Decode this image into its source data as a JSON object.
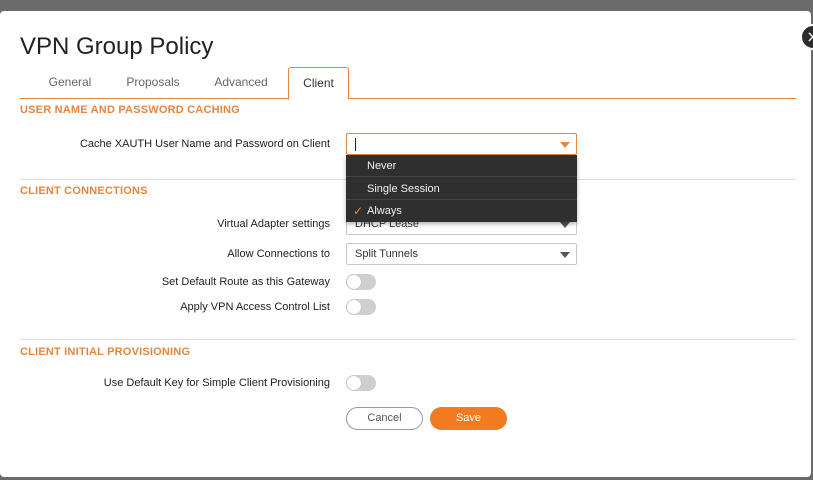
{
  "dialog": {
    "title": "VPN Group Policy",
    "close_glyph": "×"
  },
  "tabs": [
    {
      "label": "General",
      "active": false
    },
    {
      "label": "Proposals",
      "active": false
    },
    {
      "label": "Advanced",
      "active": false
    },
    {
      "label": "Client",
      "active": true
    }
  ],
  "sections": {
    "caching": {
      "title": "USER NAME AND PASSWORD CACHING",
      "cache_label": "Cache XAUTH User Name and Password on Client",
      "cache_value": ""
    },
    "connections": {
      "title": "CLIENT CONNECTIONS",
      "virtual_adapter_label": "Virtual Adapter settings",
      "virtual_adapter_value": "DHCP Lease",
      "allow_connections_label": "Allow Connections to",
      "allow_connections_value": "Split Tunnels",
      "default_route_label": "Set Default Route as this Gateway",
      "default_route_on": false,
      "acl_label": "Apply VPN Access Control List",
      "acl_on": false
    },
    "provisioning": {
      "title": "CLIENT INITIAL PROVISIONING",
      "default_key_label": "Use Default Key for Simple Client Provisioning",
      "default_key_on": false
    }
  },
  "dropdown": {
    "options": [
      {
        "label": "Never",
        "selected": false
      },
      {
        "label": "Single Session",
        "selected": false
      },
      {
        "label": "Always",
        "selected": true
      }
    ],
    "check_glyph": "✓"
  },
  "buttons": {
    "cancel_label": "Cancel",
    "save_label": "Save"
  },
  "colors": {
    "accent": "#e8853d",
    "save_button": "#f47a1f",
    "dropdown_bg": "#2f2f2f"
  }
}
